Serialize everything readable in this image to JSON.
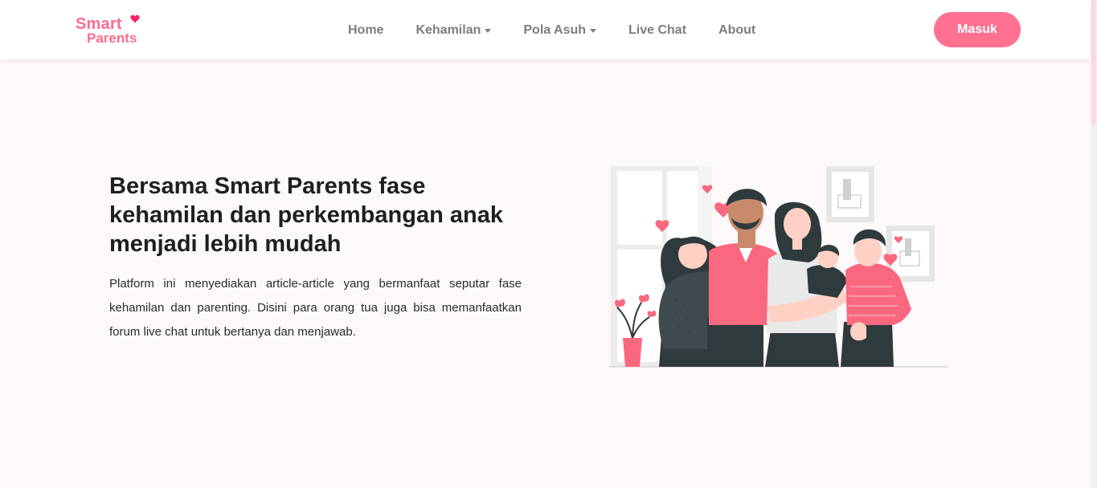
{
  "brand": {
    "line1": "Smart",
    "line2": "Parents",
    "color": "#ff6b8b",
    "heart_color": "#ff1f6b"
  },
  "nav": {
    "items": [
      {
        "label": "Home",
        "dropdown": false
      },
      {
        "label": "Kehamilan",
        "dropdown": true
      },
      {
        "label": "Pola Asuh",
        "dropdown": true
      },
      {
        "label": "Live Chat",
        "dropdown": false
      },
      {
        "label": "About",
        "dropdown": false
      }
    ],
    "login_label": "Masuk",
    "accent": "#ff7091"
  },
  "hero": {
    "title": "Bersama Smart Parents fase kehamilan dan perkembangan anak menjadi lebih mudah",
    "description": "Platform ini menyediakan article-article yang bermanfaat seputar fase kehamilan dan parenting. Disini para orang tua juga bisa memanfaatkan forum live chat untuk bertanya dan menjawab."
  },
  "illustration": {
    "subject": "family-group-illustration",
    "palette": [
      "#f9687f",
      "#2f3a3c",
      "#ffffff",
      "#e9e9e9"
    ]
  }
}
